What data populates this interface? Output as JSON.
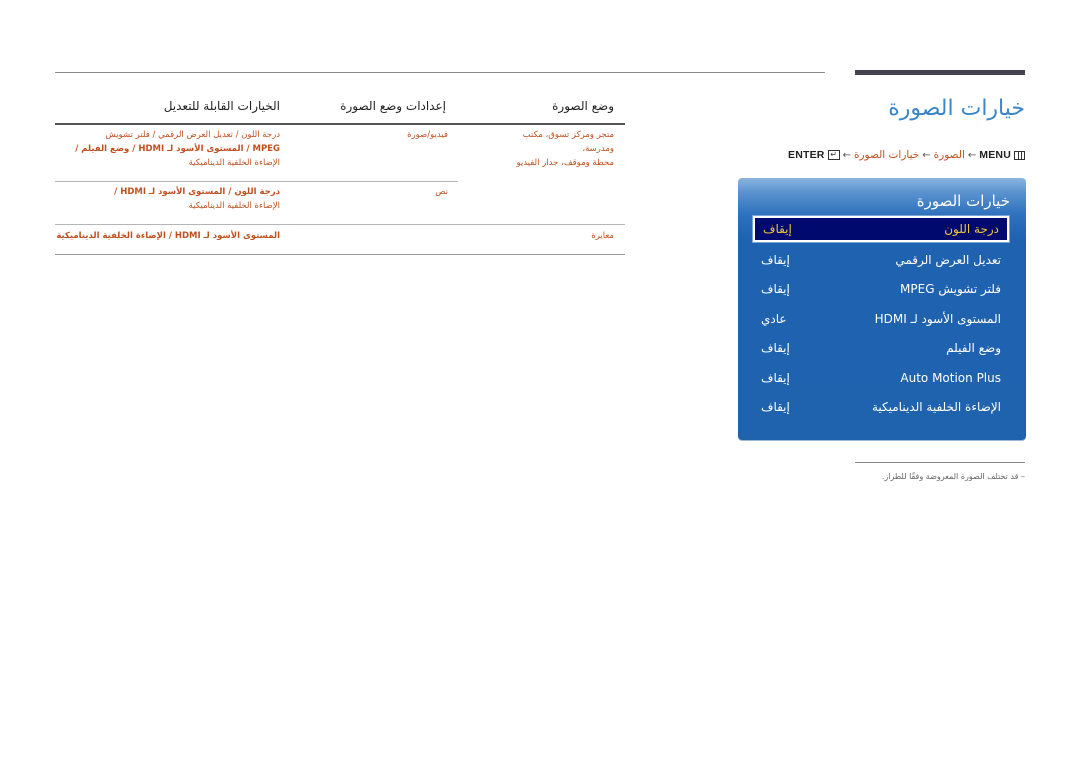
{
  "page": {
    "title": "خيارات الصورة",
    "path": {
      "menu_label": "MENU",
      "menu_icon": "menu-icon",
      "arrow": "←",
      "step1": "الصورة",
      "step2": "خيارات الصورة",
      "enter_icon": "enter-icon",
      "enter_label": "ENTER"
    },
    "footnote": "–  قد تختلف الصورة المعروضة وفقًا للطراز."
  },
  "osd": {
    "title": "خيارات الصورة",
    "items": [
      {
        "label": "درجة اللون",
        "value": "إيقاف",
        "selected": true
      },
      {
        "label": "تعديل العرض الرقمي",
        "value": "إيقاف"
      },
      {
        "label": "فلتر تشويش MPEG",
        "value": "إيقاف"
      },
      {
        "label": "المستوى الأسود لـ HDMI",
        "value": "عادي"
      },
      {
        "label": "وضع الفيلم",
        "value": "إيقاف"
      },
      {
        "label": "Auto Motion Plus",
        "value": "إيقاف"
      },
      {
        "label": "الإضاءة الخلفية الديناميكية",
        "value": "إيقاف"
      }
    ],
    "colors": {
      "panel": "#1f62ae",
      "selected_bg": "#000a6e",
      "selected_text": "#f2c33a"
    }
  },
  "table": {
    "headers": [
      "وضع الصورة",
      "إعدادات وضع الصورة",
      "الخيارات القابلة للتعديل"
    ],
    "rows": [
      {
        "mode": "متجر ومركز تسوق، مكتب ومدرسة، محطة وموقف، جدار الفيديو",
        "mode_line1": "متجر ومركز تسوق، مكتب ومدرسة،",
        "mode_line2": "محطة وموقف، جدار الفيديو",
        "settings": [
          {
            "name": "فيديو/صورة",
            "options_line1": "درجة اللون / تعديل العرض الرقمي / فلتر تشويش",
            "options_line2": "MPEG / المستوى الأسود لـ HDMI / وضع الفيلم /",
            "options_line3": "الإضاءة الخلفية الديناميكية"
          },
          {
            "name": "نص",
            "options_line1": "درجة اللون / المستوى الأسود لـ HDMI /",
            "options_line2": "الإضاءة الخلفية الديناميكية"
          }
        ]
      },
      {
        "mode": "معايرة",
        "settings": [
          {
            "name": "",
            "options_line1": "المستوى الأسود لـ HDMI / الإضاءة الخلفية الديناميكية"
          }
        ]
      }
    ],
    "link_color": "#c0501f"
  }
}
